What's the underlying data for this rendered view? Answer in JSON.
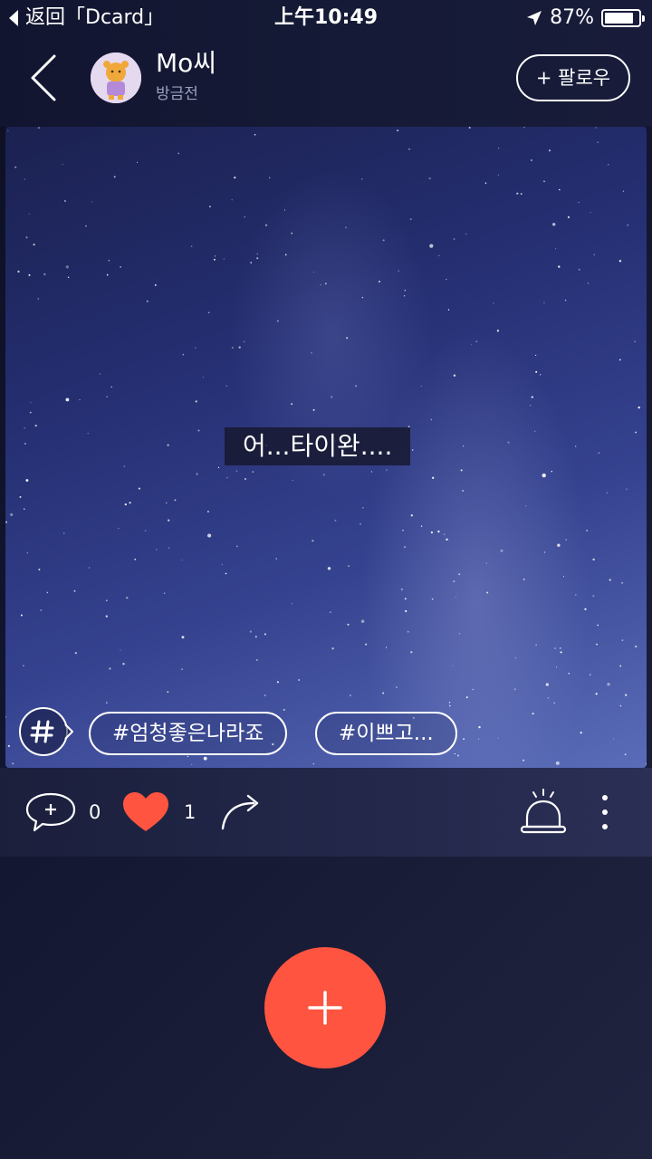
{
  "status_bar": {
    "back_app": "返回「Dcard」",
    "time": "上午10:49",
    "battery": "87%",
    "battery_level": 0.87
  },
  "post": {
    "author": "Mo씨",
    "time_ago": "방금전",
    "follow_label": "+ 팔로우",
    "caption": "어...타이완....",
    "hashtags": [
      "#엄청좋은나라죠",
      "#이쁘고..."
    ],
    "comment_count": "0",
    "like_count": "1"
  },
  "colors": {
    "accent": "#ff5440",
    "like": "#ff5440"
  },
  "icons": {
    "back": "chevron-left-icon",
    "comment": "comment-add-icon",
    "like": "heart-icon",
    "share": "share-arrow-icon",
    "report": "siren-icon",
    "more": "more-vertical-icon",
    "fab": "plus-icon",
    "hashtag": "hashtag-icon",
    "location": "location-arrow-icon"
  }
}
